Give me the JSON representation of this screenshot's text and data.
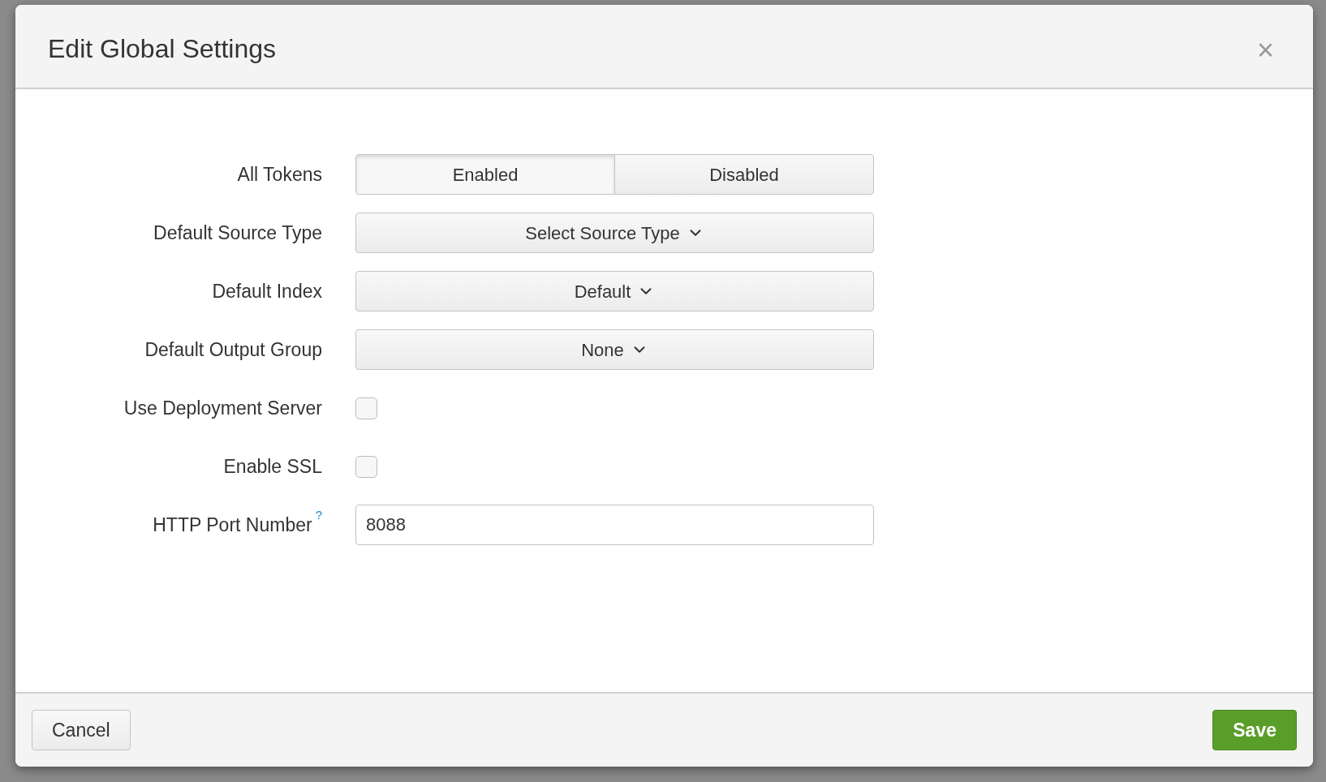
{
  "dialog": {
    "title": "Edit Global Settings",
    "close": "×"
  },
  "fields": [
    {
      "kind": "toggle",
      "label": "All Tokens",
      "options": [
        {
          "label": "Enabled",
          "selected": true
        },
        {
          "label": "Disabled",
          "selected": false
        }
      ]
    },
    {
      "kind": "dropdown",
      "label": "Default Source Type",
      "value": "Select Source Type"
    },
    {
      "kind": "dropdown",
      "label": "Default Index",
      "value": "Default"
    },
    {
      "kind": "dropdown",
      "label": "Default Output Group",
      "value": "None"
    },
    {
      "kind": "checkbox",
      "label": "Use Deployment Server",
      "checked": false
    },
    {
      "kind": "checkbox",
      "label": "Enable SSL",
      "checked": false
    },
    {
      "kind": "text",
      "label": "HTTP Port Number",
      "help": "?",
      "value": "8088"
    }
  ],
  "footer": {
    "cancel": "Cancel",
    "save": "Save"
  }
}
